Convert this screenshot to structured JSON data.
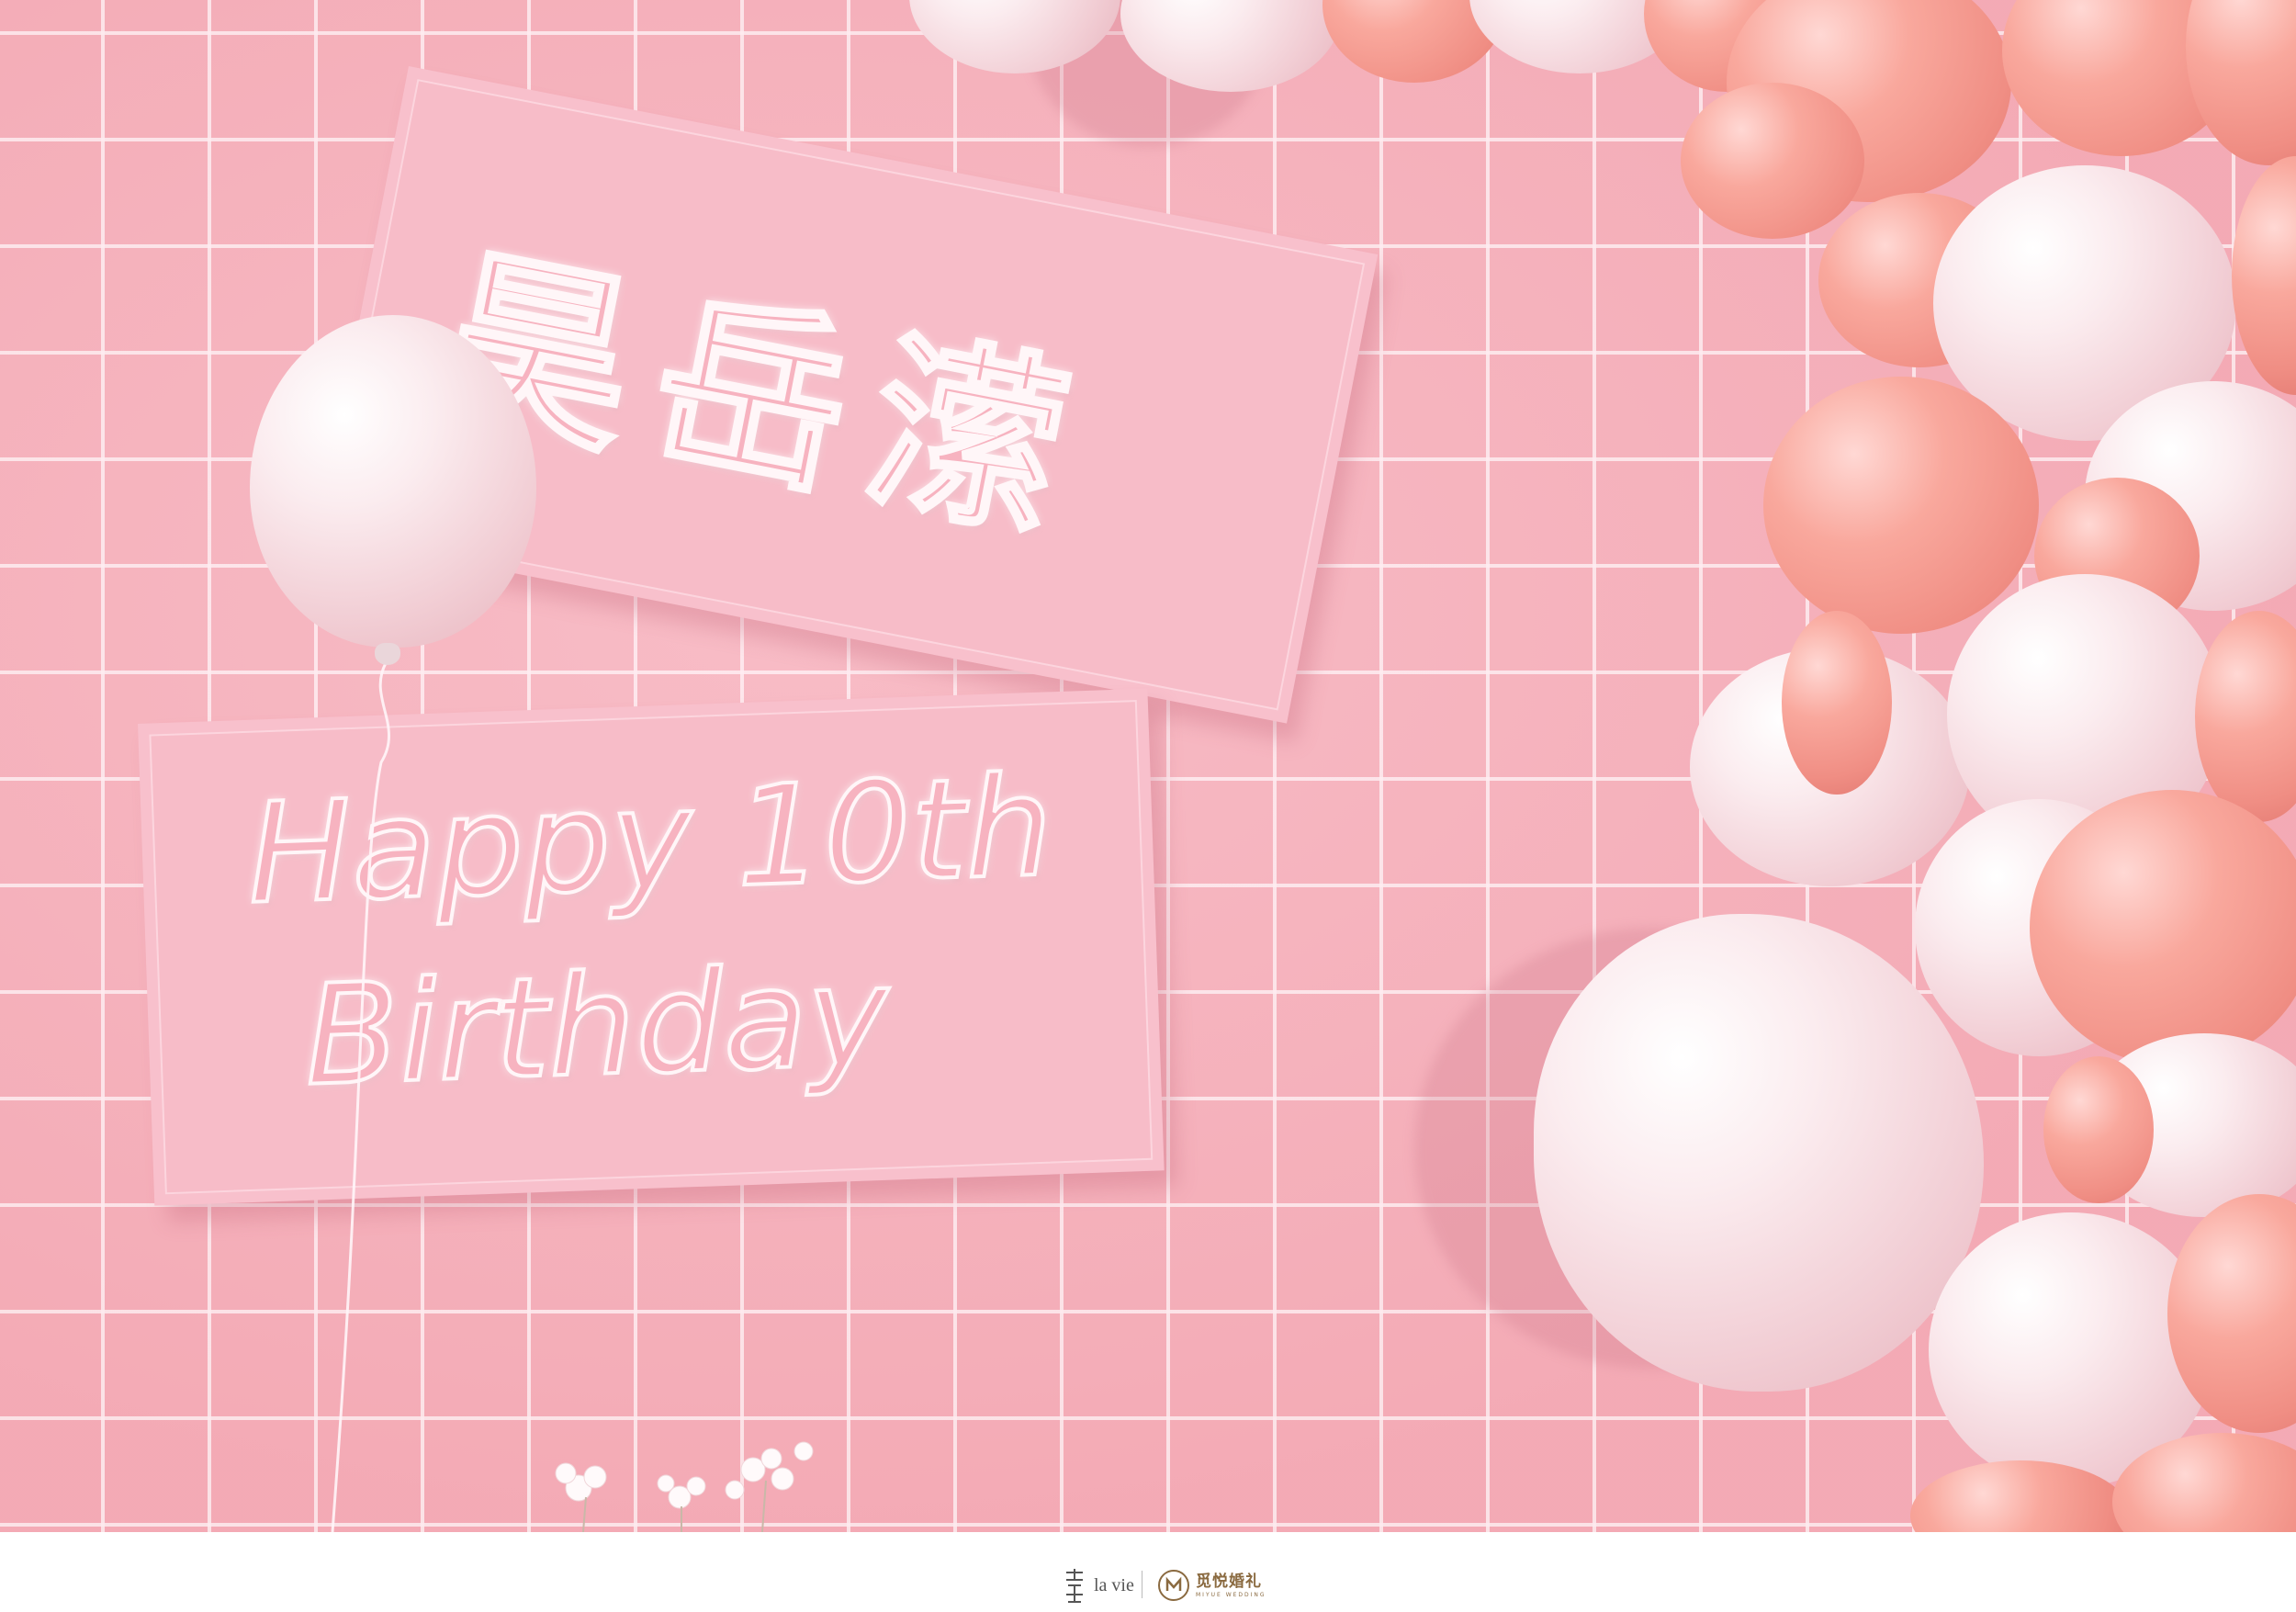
{
  "photo": {
    "backdrop": "pink grid wall with pink and white balloon garland",
    "colors": {
      "wall": "#f4aeb8",
      "grid_line": "#fff8fa",
      "sign": "#f7bcc8",
      "balloon_pink": "#f08e84",
      "balloon_white": "#fbecef"
    }
  },
  "signs": {
    "name": "昊岳潆",
    "birthday_line1": "Happy 10th",
    "birthday_line2": "Birthday"
  },
  "footer": {
    "logo_lavie": "la vie",
    "logo_miyue": "觅悦婚礼",
    "logo_miyue_sub": "MIYUE WEDDING"
  }
}
